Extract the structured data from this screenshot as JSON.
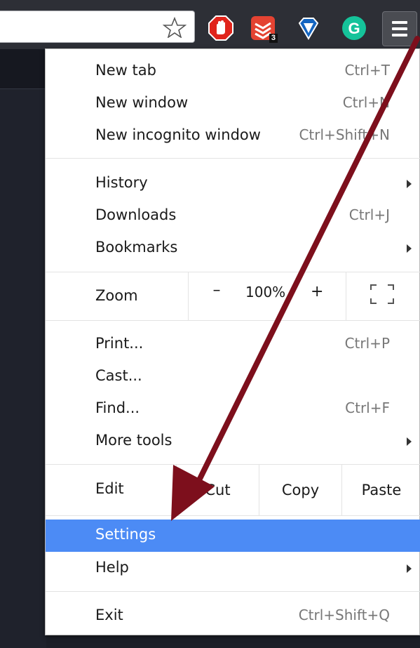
{
  "toolbar": {
    "extensions": [
      {
        "name": "adblock-extension-icon",
        "color": "#e0241b"
      },
      {
        "name": "todoist-extension-icon",
        "color": "#e44332",
        "badge": "3"
      },
      {
        "name": "diamond-extension-icon",
        "color": "#1565c0"
      },
      {
        "name": "grammarly-extension-icon",
        "color": "#15c39a",
        "glyph": "G"
      }
    ]
  },
  "menu": {
    "new_tab": {
      "label": "New tab",
      "shortcut": "Ctrl+T"
    },
    "new_window": {
      "label": "New window",
      "shortcut": "Ctrl+N"
    },
    "new_incognito": {
      "label": "New incognito window",
      "shortcut": "Ctrl+Shift+N"
    },
    "history": {
      "label": "History"
    },
    "downloads": {
      "label": "Downloads",
      "shortcut": "Ctrl+J"
    },
    "bookmarks": {
      "label": "Bookmarks"
    },
    "zoom": {
      "label": "Zoom",
      "minus": "–",
      "value": "100%",
      "plus": "+"
    },
    "print": {
      "label": "Print...",
      "shortcut": "Ctrl+P"
    },
    "cast": {
      "label": "Cast..."
    },
    "find": {
      "label": "Find...",
      "shortcut": "Ctrl+F"
    },
    "more_tools": {
      "label": "More tools"
    },
    "edit": {
      "label": "Edit",
      "cut": "Cut",
      "copy": "Copy",
      "paste": "Paste"
    },
    "settings": {
      "label": "Settings"
    },
    "help": {
      "label": "Help"
    },
    "exit": {
      "label": "Exit",
      "shortcut": "Ctrl+Shift+Q"
    }
  },
  "colors": {
    "highlight": "#4c8bf5",
    "annotation_arrow": "#7d0f1c"
  }
}
